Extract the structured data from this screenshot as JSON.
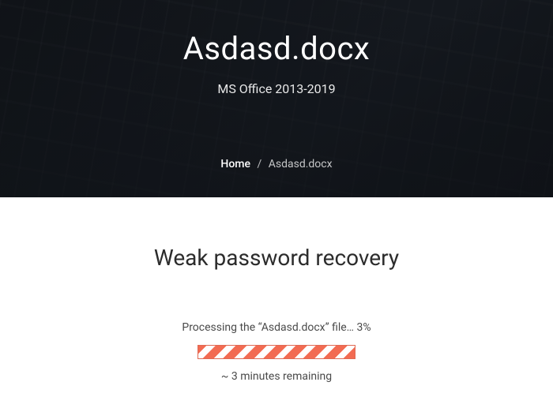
{
  "hero": {
    "title": "Asdasd.docx",
    "subtitle": "MS Office 2013-2019"
  },
  "breadcrumb": {
    "home": "Home",
    "sep": "/",
    "current": "Asdasd.docx"
  },
  "main": {
    "heading": "Weak password recovery",
    "status": "Processing the “Asdasd.docx” file… 3%",
    "progress_percent": 3,
    "remaining": "~ 3 minutes remaining"
  },
  "colors": {
    "accent": "#f26b52",
    "hero_bg": "#1a1e24"
  }
}
